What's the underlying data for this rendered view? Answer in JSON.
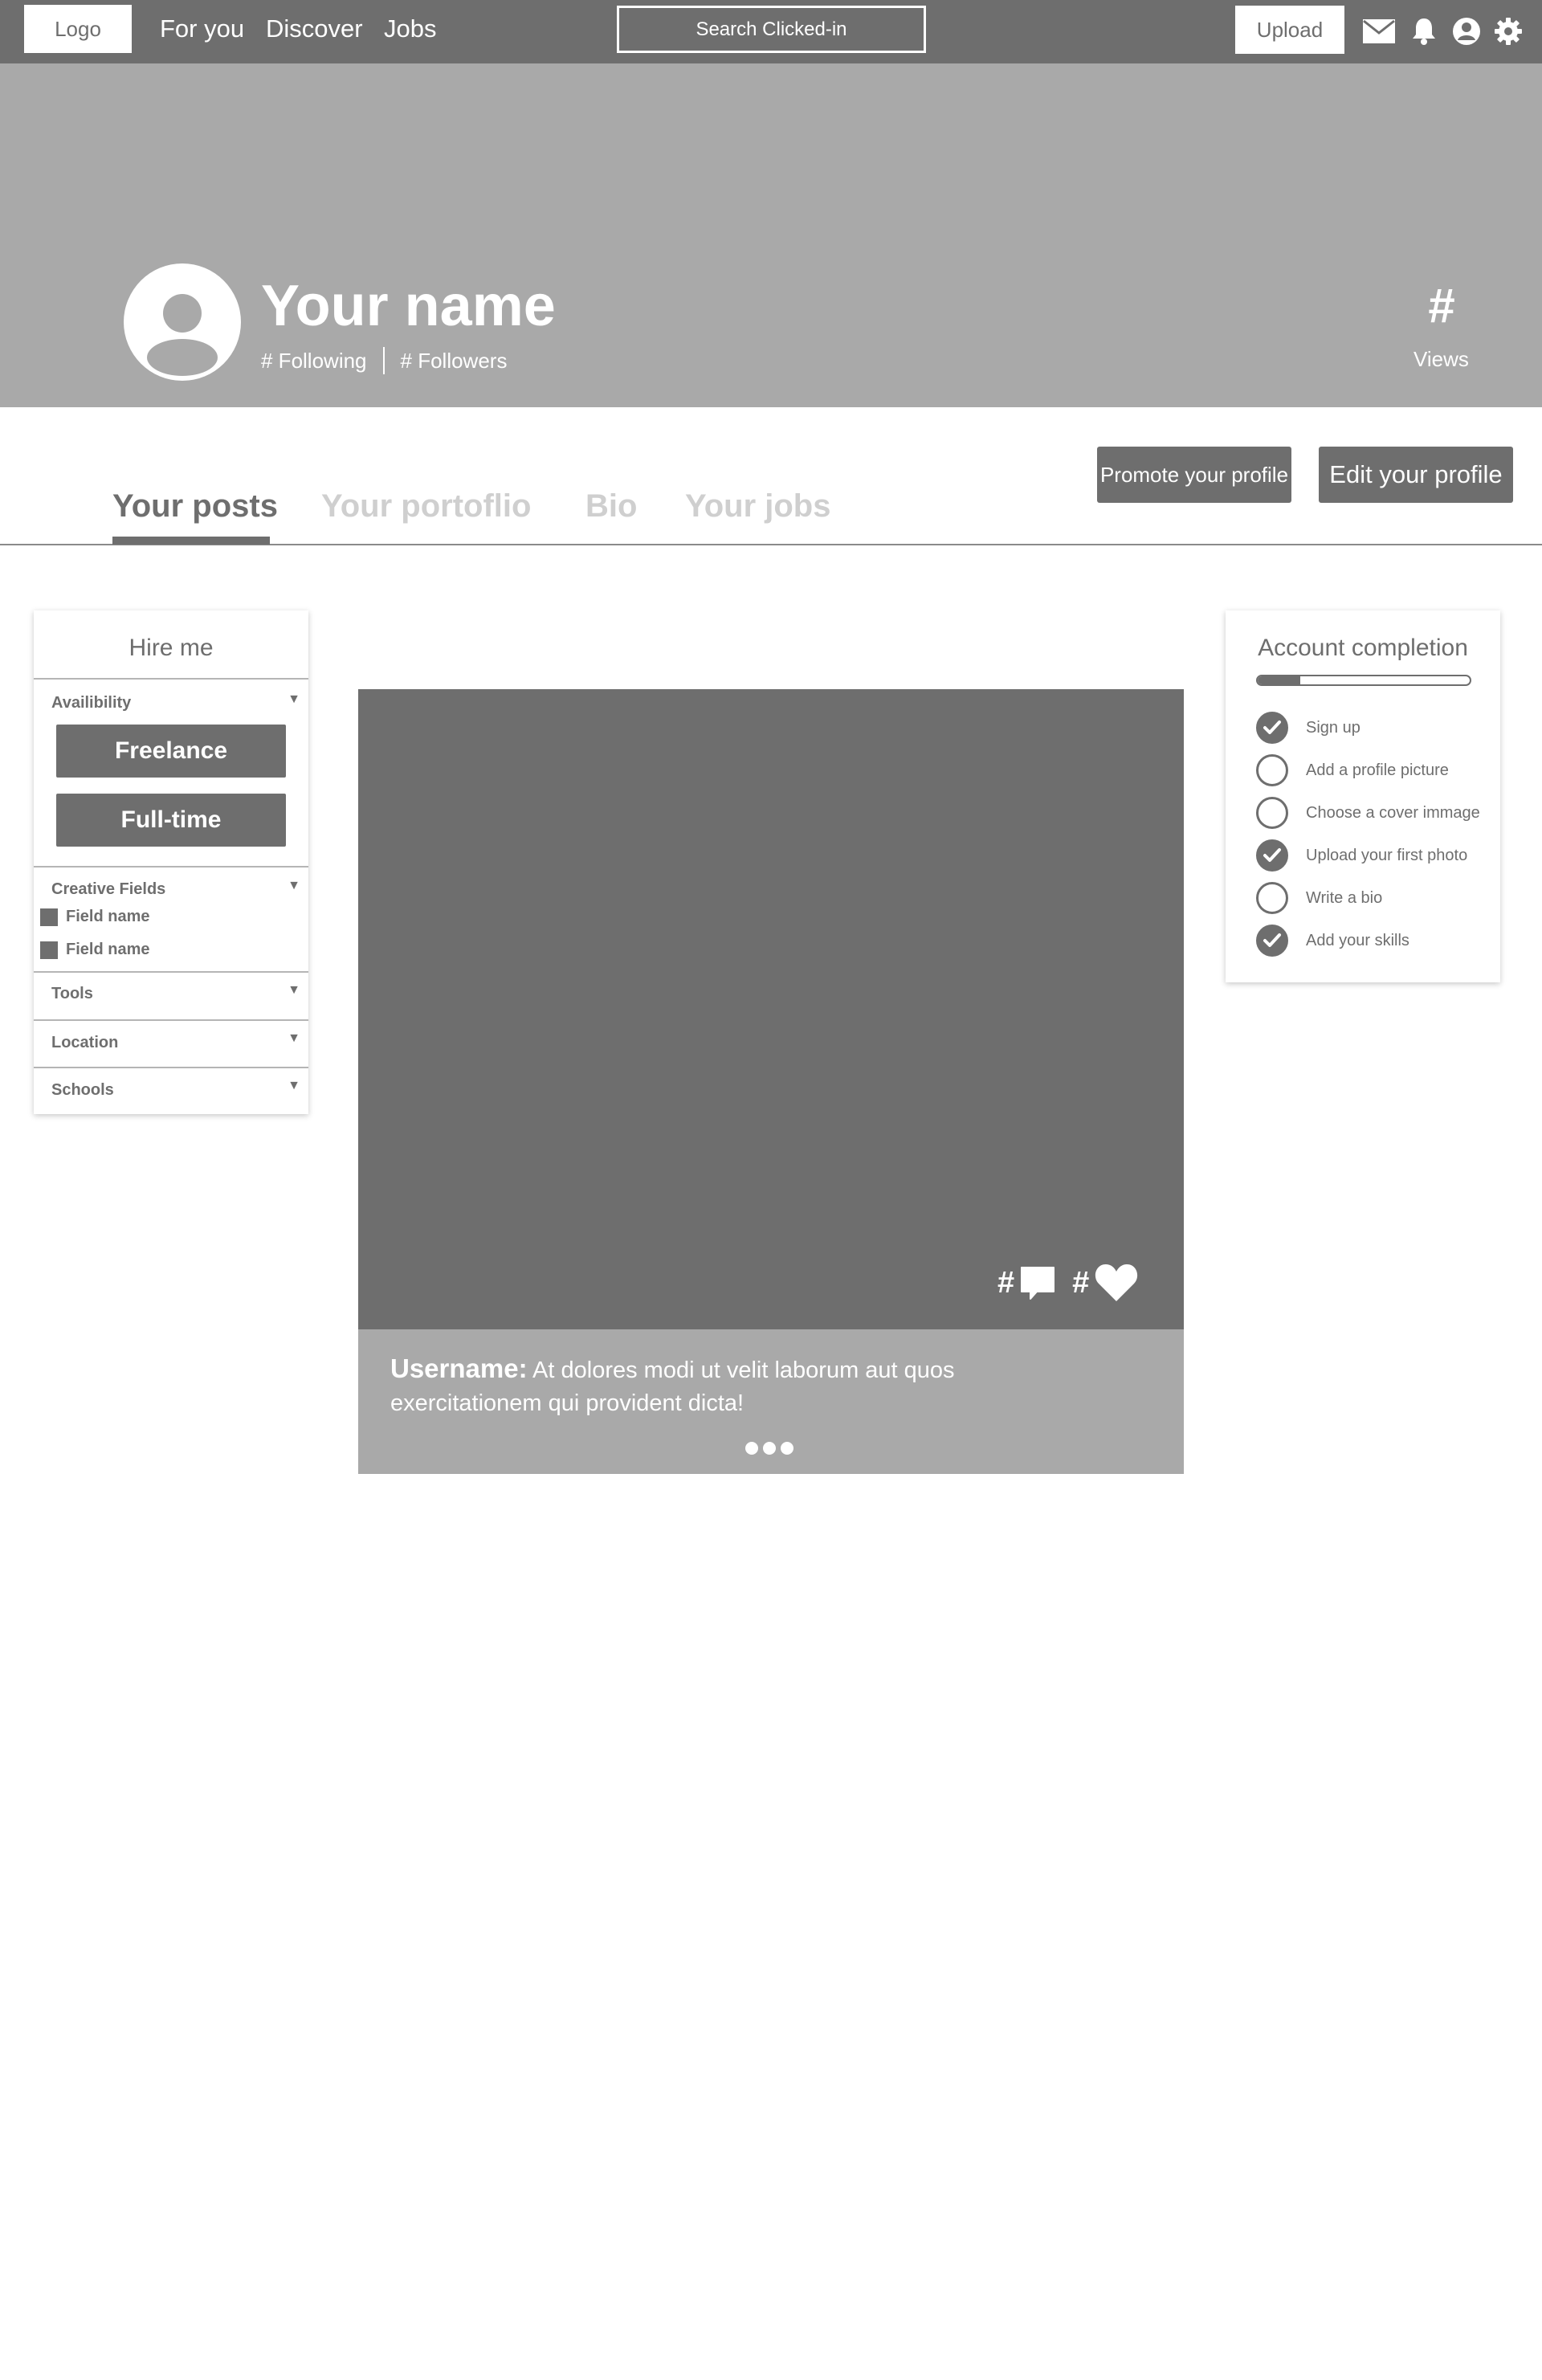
{
  "nav": {
    "logo": "Logo",
    "links": [
      "For you",
      "Discover",
      "Jobs"
    ],
    "search_placeholder": "Search Clicked-in",
    "upload": "Upload",
    "icons": [
      "mail-icon",
      "bell-icon",
      "user-icon",
      "gear-icon"
    ]
  },
  "profile": {
    "name": "Your name",
    "following": "# Following",
    "followers": "# Followers",
    "views_count": "#",
    "views_label": "Views"
  },
  "tabs": [
    "Your posts",
    "Your portoflio",
    "Bio",
    "Your jobs"
  ],
  "actions": {
    "promote": "Promote your profile",
    "edit": "Edit your profile"
  },
  "hire_panel": {
    "title": "Hire me",
    "availability_label": "Availibility",
    "freelance": "Freelance",
    "fulltime": "Full-time",
    "creative_fields_label": "Creative Fields",
    "fields": [
      "Field name",
      "Field name"
    ],
    "tools_label": "Tools",
    "location_label": "Location",
    "schools_label": "Schools"
  },
  "post": {
    "comments_count": "#",
    "likes_count": "#",
    "username": "Username:",
    "caption": "At dolores modi ut velit laborum aut quos  exercitationem qui provident dicta!"
  },
  "completion": {
    "title": "Account completion",
    "progress": 0.2,
    "tasks": [
      {
        "label": "Sign up",
        "done": true
      },
      {
        "label": "Add a profile picture",
        "done": false
      },
      {
        "label": "Choose a cover immage",
        "done": false
      },
      {
        "label": "Upload your first photo",
        "done": true
      },
      {
        "label": "Write a bio",
        "done": false
      },
      {
        "label": "Add your skills",
        "done": true
      }
    ]
  },
  "colors": {
    "dark": "#6e6e6e",
    "cover": "#a9a9a9",
    "inactive_tab": "#cfcfcf"
  }
}
